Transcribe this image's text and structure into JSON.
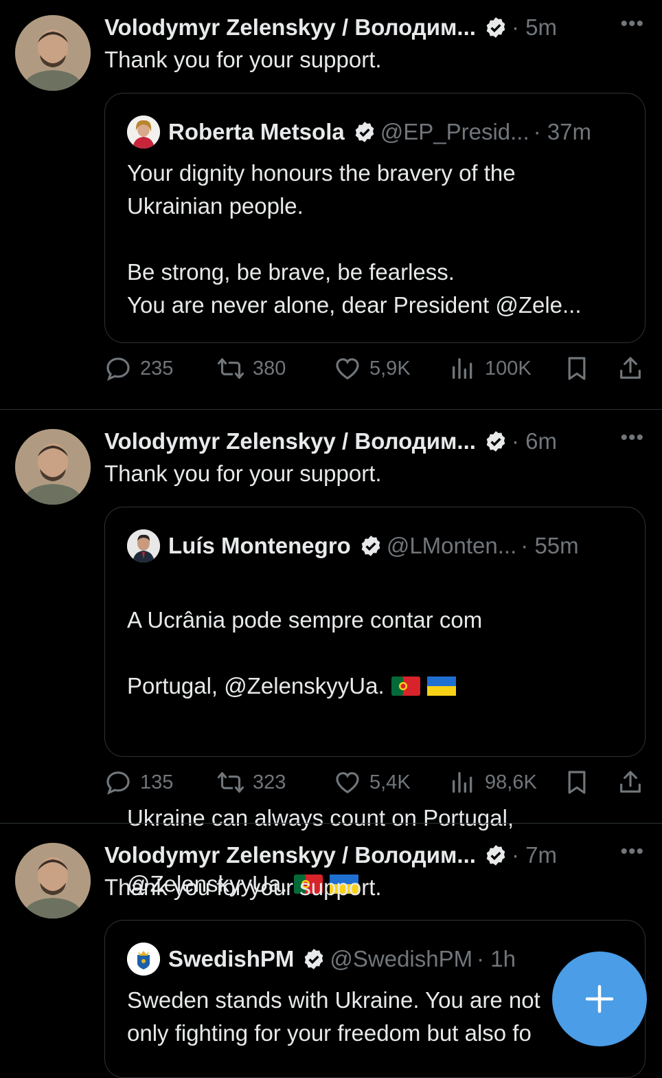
{
  "feed": [
    {
      "author": "Volodymyr Zelenskyy / Володим...",
      "time": "5m",
      "text": "Thank you for your support.",
      "quote": {
        "author": "Roberta Metsola",
        "handle": "@EP_Presid...",
        "time": "37m",
        "text": "Your dignity honours the bravery of the\nUkrainian people.\n\nBe strong, be brave, be fearless.\nYou are never alone, dear President @Zele..."
      },
      "stats": {
        "replies": "235",
        "reposts": "380",
        "likes": "5,9K",
        "views": "100K"
      }
    },
    {
      "author": "Volodymyr Zelenskyy / Володим...",
      "time": "6m",
      "text": "Thank you for your support.",
      "quote": {
        "author": "Luís Montenegro",
        "handle": "@LMonten...",
        "time": "55m",
        "text_line1": "A Ucrânia pode sempre contar com",
        "text_line2": "Portugal, @ZelenskyyUa.",
        "text_line3": "Ukraine can always count on Portugal,",
        "text_line4": "@ZelenskyyUa."
      },
      "stats": {
        "replies": "135",
        "reposts": "323",
        "likes": "5,4K",
        "views": "98,6K"
      }
    },
    {
      "author": "Volodymyr Zelenskyy / Володим...",
      "time": "7m",
      "text": "Thank you for your support.",
      "quote": {
        "author": "SwedishPM",
        "handle": "@SwedishPM",
        "time": "1h",
        "text": "Sweden stands with Ukraine. You are not\nonly fighting for your freedom but also fo"
      }
    }
  ],
  "fab_icon": "plus-icon",
  "colors": {
    "accent": "#4a9de6",
    "verified": "#e7e9ea",
    "muted": "#71767b"
  }
}
